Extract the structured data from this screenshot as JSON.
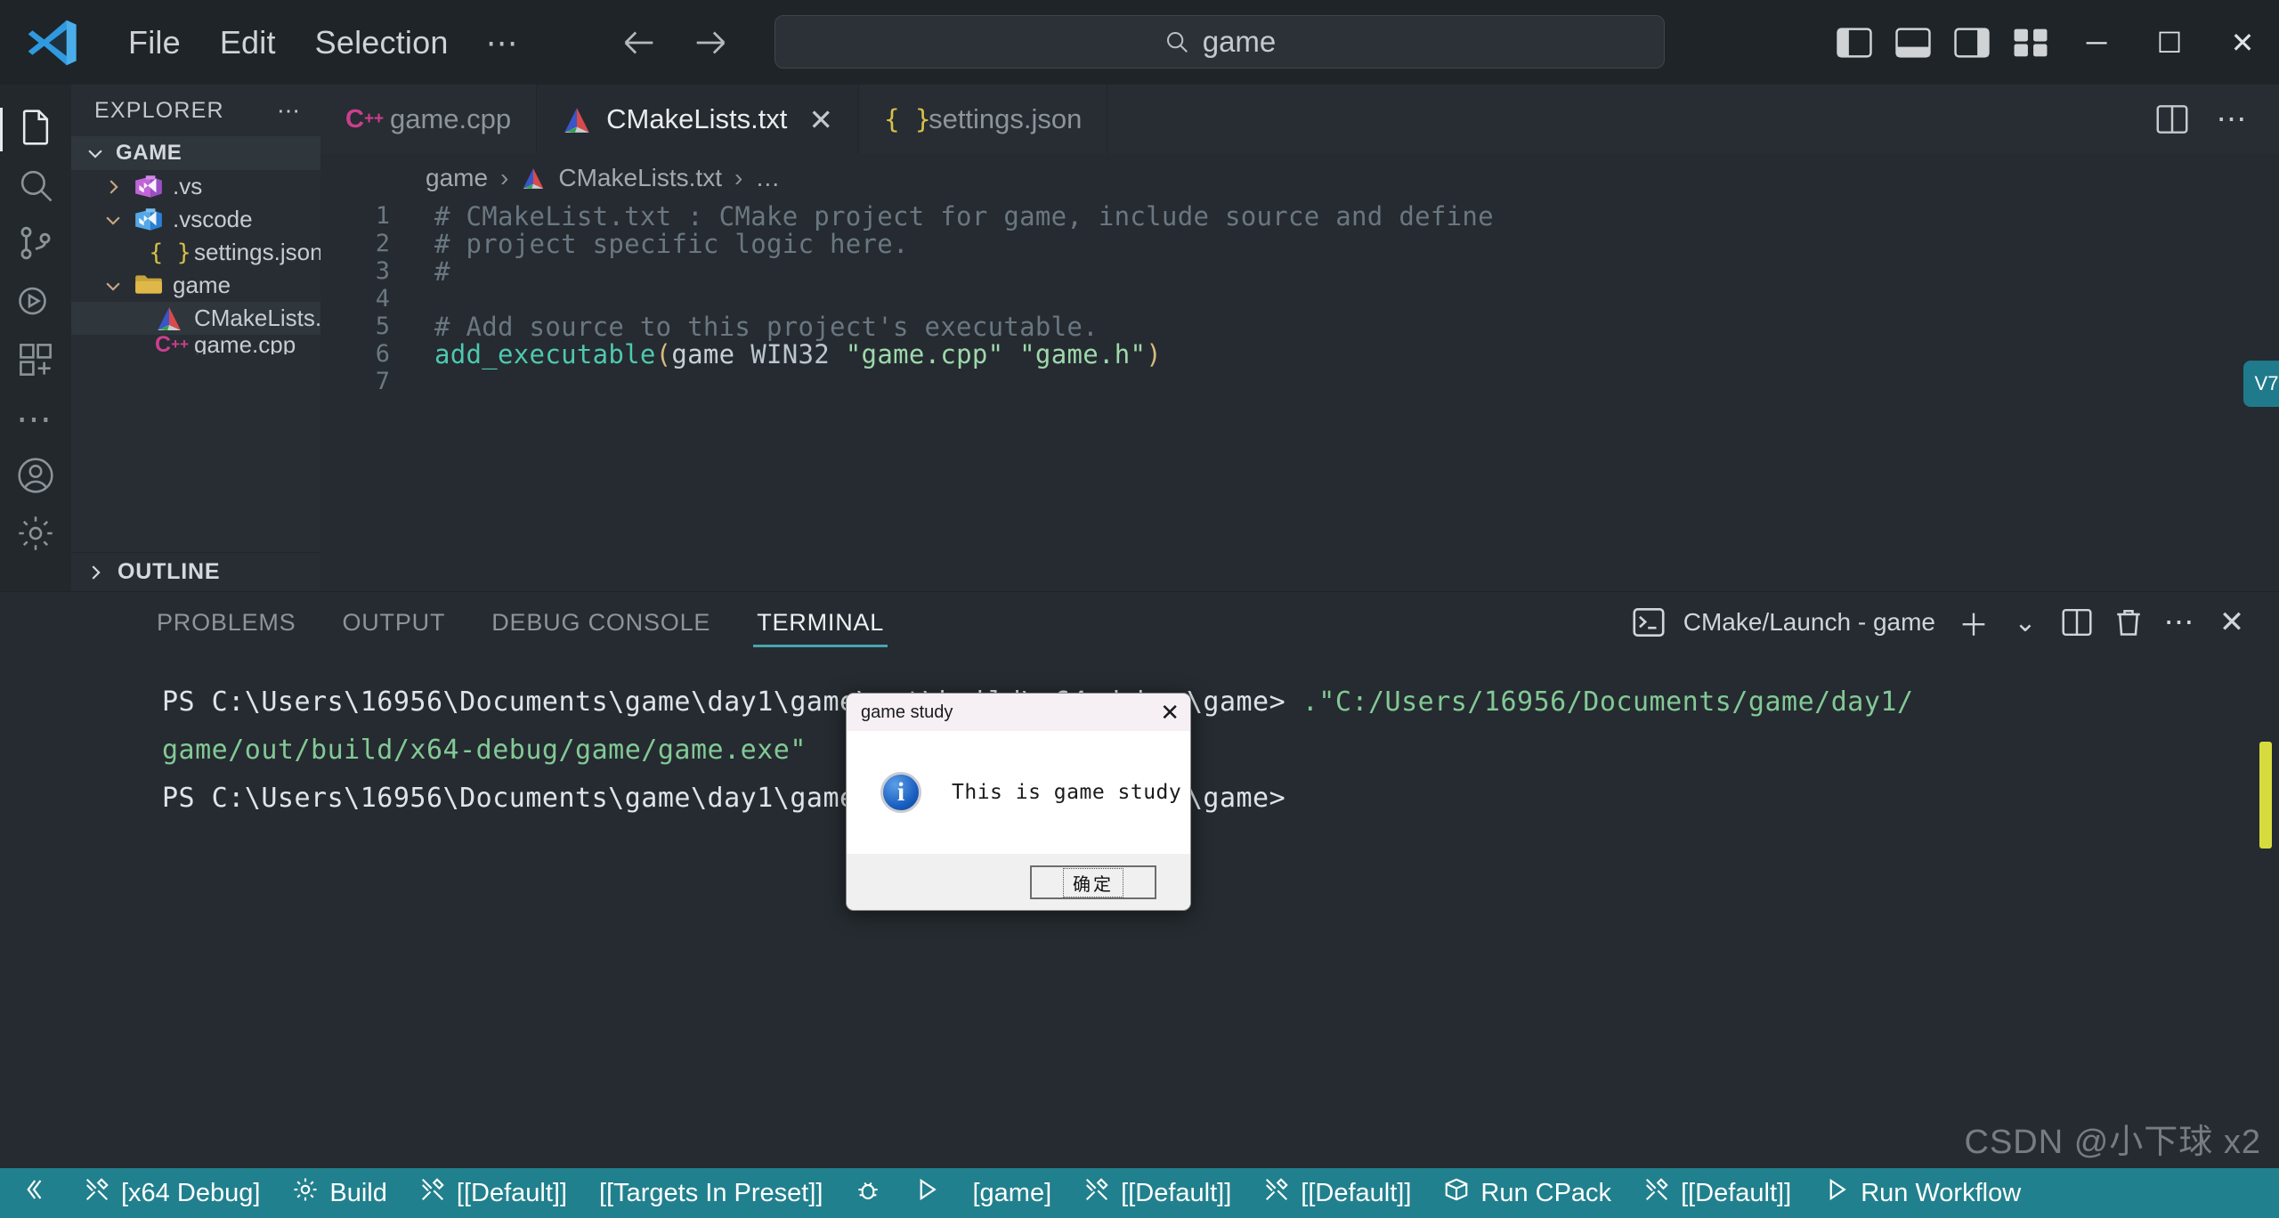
{
  "titlebar": {
    "logo_name": "vscode-logo",
    "menus": [
      "File",
      "Edit",
      "Selection",
      "⋯"
    ],
    "nav_back": "back-arrow",
    "nav_forward": "forward-arrow",
    "search": {
      "value": "game",
      "placeholder": "Search"
    },
    "layout_buttons": [
      "toggle-primary-sidebar",
      "toggle-panel",
      "toggle-secondary-sidebar",
      "customize-layout"
    ],
    "window_buttons": {
      "minimize": "─",
      "maximize": "☐",
      "close": "✕"
    }
  },
  "activitybar": {
    "items": [
      {
        "name": "explorer",
        "icon": "files-icon",
        "active": true
      },
      {
        "name": "search",
        "icon": "search-icon",
        "active": false
      },
      {
        "name": "source-control",
        "icon": "source-control-icon",
        "active": false
      },
      {
        "name": "run-and-debug",
        "icon": "run-debug-icon",
        "active": false
      },
      {
        "name": "extensions",
        "icon": "extensions-icon",
        "active": false
      },
      {
        "name": "more",
        "icon": "ellipsis-icon",
        "active": false
      }
    ],
    "bottom": [
      {
        "name": "accounts",
        "icon": "account-icon"
      },
      {
        "name": "manage",
        "icon": "gear-icon"
      }
    ]
  },
  "sidebar": {
    "title": "EXPLORER",
    "more_actions": "⋯",
    "root": {
      "label": "GAME",
      "expanded": true
    },
    "tree": [
      {
        "label": ".vs",
        "icon": "vs-folder-icon",
        "indent": 1,
        "chevron": "right",
        "selected": false
      },
      {
        "label": ".vscode",
        "icon": "vscode-folder-icon",
        "indent": 1,
        "chevron": "down",
        "selected": false
      },
      {
        "label": "settings.json",
        "icon": "json-icon",
        "indent": 2,
        "chevron": "none",
        "selected": false
      },
      {
        "label": "game",
        "icon": "folder-icon",
        "indent": 1,
        "chevron": "down",
        "selected": false
      },
      {
        "label": "CMakeLists.txt",
        "icon": "cmake-icon",
        "indent": 2,
        "chevron": "none",
        "selected": true
      },
      {
        "label": "game.cpp",
        "icon": "cpp-icon",
        "indent": 2,
        "chevron": "none",
        "selected": false
      }
    ],
    "outline": {
      "label": "OUTLINE",
      "expanded": false
    }
  },
  "editor": {
    "tabs": [
      {
        "label": "game.cpp",
        "icon": "cpp-icon",
        "active": false,
        "closable": false
      },
      {
        "label": "CMakeLists.txt",
        "icon": "cmake-icon",
        "active": true,
        "closable": true,
        "close": "✕"
      },
      {
        "label": "settings.json",
        "icon": "json-icon",
        "active": false,
        "closable": false
      }
    ],
    "tab_actions": [
      "split-editor-icon",
      "more-actions-icon"
    ],
    "breadcrumb": [
      "game",
      "CMakeLists.txt",
      "…"
    ],
    "breadcrumb_icon": "cmake-icon",
    "badge": "V7",
    "lines": [
      {
        "num": "1",
        "segments": [
          {
            "t": "# CMakeList.txt : CMake project for game, include source and define",
            "c": "cmt"
          }
        ]
      },
      {
        "num": "2",
        "segments": [
          {
            "t": "# project specific logic here.",
            "c": "cmt"
          }
        ]
      },
      {
        "num": "3",
        "segments": [
          {
            "t": "#",
            "c": "cmt"
          }
        ]
      },
      {
        "num": "4",
        "segments": [
          {
            "t": "",
            "c": "cmt"
          }
        ]
      },
      {
        "num": "5",
        "segments": [
          {
            "t": "# Add source to this project's executable.",
            "c": "cmt"
          }
        ]
      },
      {
        "num": "6",
        "segments": [
          {
            "t": "add_executable",
            "c": "fn"
          },
          {
            "t": "(",
            "c": "paren"
          },
          {
            "t": "game ",
            "c": "arg"
          },
          {
            "t": "WIN32",
            "c": "kw"
          },
          {
            "t": " ",
            "c": "arg"
          },
          {
            "t": "\"game.cpp\"",
            "c": "str"
          },
          {
            "t": " ",
            "c": "arg"
          },
          {
            "t": "\"game.h\"",
            "c": "str"
          },
          {
            "t": ")",
            "c": "paren"
          }
        ]
      },
      {
        "num": "7",
        "segments": [
          {
            "t": "",
            "c": "cmt"
          }
        ]
      }
    ]
  },
  "panel": {
    "tabs": [
      {
        "label": "PROBLEMS",
        "active": false
      },
      {
        "label": "OUTPUT",
        "active": false
      },
      {
        "label": "DEBUG CONSOLE",
        "active": false
      },
      {
        "label": "TERMINAL",
        "active": true
      }
    ],
    "terminal_selector": {
      "icon": "terminal-icon",
      "label": "CMake/Launch - game"
    },
    "actions": [
      {
        "name": "new-terminal-button",
        "glyph": "＋"
      },
      {
        "name": "terminal-dropdown-icon",
        "glyph": "⌄"
      },
      {
        "name": "split-terminal-button",
        "glyph": "split"
      },
      {
        "name": "kill-terminal-button",
        "glyph": "trash"
      },
      {
        "name": "panel-more-actions",
        "glyph": "⋯"
      },
      {
        "name": "close-panel-button",
        "glyph": "✕"
      }
    ],
    "terminal_lines": [
      {
        "parts": [
          {
            "t": "PS C:\\Users\\16956\\Documents\\game\\day1\\game\\out\\build\\x64-debug\\game> ",
            "c": "t-white"
          },
          {
            "t": ".\"C:/Users/16956/Documents/game/day1/",
            "c": "t-green"
          }
        ]
      },
      {
        "parts": [
          {
            "t": "game/out/build/x64-debug/game/game.exe\"",
            "c": "t-green"
          }
        ]
      },
      {
        "parts": [
          {
            "t": "PS C:\\Users\\16956\\Documents\\game\\day1\\game\\out\\build\\x64-debug\\game> ",
            "c": "t-white"
          }
        ]
      }
    ]
  },
  "dialog": {
    "title": "game study",
    "close": "✕",
    "icon": "info-icon",
    "message": "This is game study",
    "ok_button": "确定"
  },
  "statusbar": {
    "items": [
      {
        "icon": "remote-icon",
        "label": ""
      },
      {
        "icon": "tools-icon",
        "label": "[x64 Debug]"
      },
      {
        "icon": "gear-icon",
        "label": "Build"
      },
      {
        "icon": "tools-icon",
        "label": "[[Default]]"
      },
      {
        "icon": "none",
        "label": "[[Targets In Preset]]"
      },
      {
        "icon": "bug-icon",
        "label": ""
      },
      {
        "icon": "play-icon",
        "label": ""
      },
      {
        "icon": "none",
        "label": "[game]"
      },
      {
        "icon": "tools-icon",
        "label": "[[Default]]"
      },
      {
        "icon": "tools-icon",
        "label": "[[Default]]"
      },
      {
        "icon": "cpack-icon",
        "label": "Run CPack"
      },
      {
        "icon": "tools-icon",
        "label": "[[Default]]"
      },
      {
        "icon": "play-icon",
        "label": "Run Workflow"
      }
    ]
  },
  "watermark": "CSDN @小下球 x2",
  "colors": {
    "titlebar_bg": "#1f2428",
    "editor_bg": "#252b30",
    "sidebar_bg": "#272d32",
    "activitybar_bg": "#22282c",
    "statusbar_bg": "#21808d",
    "accent": "#4aa3ae",
    "comment": "#6a7781",
    "function": "#4ec9b0",
    "string": "#9fd8ac",
    "paren": "#d7ba7d",
    "terminal_green": "#83c996"
  }
}
